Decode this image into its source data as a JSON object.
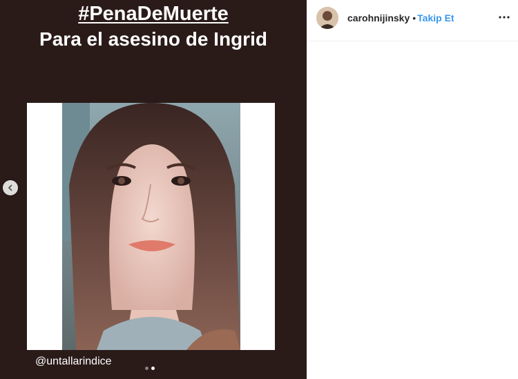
{
  "post": {
    "hashtag": "#PenaDeMuerte",
    "subtitle": "Para el asesino de Ingrid",
    "credit": "@untallarindice",
    "carousel_total": 2,
    "carousel_active": 2
  },
  "header": {
    "username": "carohnijinsky",
    "separator": "•",
    "follow_label": "Takip Et"
  },
  "icons": {
    "previous": "chevron-left-icon",
    "more": "more-options-icon",
    "avatar": "avatar"
  },
  "colors": {
    "media_background": "#2a1b19",
    "accent": "#3897f0",
    "text": "#262626"
  }
}
